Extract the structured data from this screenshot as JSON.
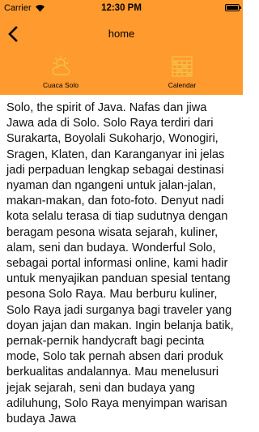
{
  "status_bar": {
    "carrier": "Carrier",
    "time": "12:30 PM"
  },
  "nav": {
    "title": "home",
    "back_icon": "chevron-left-icon"
  },
  "toolbar": {
    "items": [
      {
        "label": "Cuaca Solo",
        "icon": "weather-sun-cloud-icon"
      },
      {
        "label": "Calendar",
        "icon": "calendar-grid-icon"
      }
    ]
  },
  "colors": {
    "accent": "#fe9a2e",
    "icon": "#f5c04a"
  },
  "article": {
    "text": "Solo, the spirit of Java. Nafas dan jiwa Jawa ada di Solo. Solo Raya terdiri dari Surakarta, Boyolali Sukoharjo, Wonogiri, Sragen, Klaten, dan Karanganyar ini jelas jadi perpaduan lengkap sebagai destinasi nyaman dan ngangeni untuk jalan-jalan, makan-makan, dan foto-foto. Denyut nadi kota selalu terasa di tiap sudutnya dengan beragam pesona wisata sejarah, kuliner, alam, seni dan budaya. Wonderful Solo, sebagai portal informasi online, kami hadir untuk menyajikan panduan spesial tentang pesona Solo Raya. Mau berburu kuliner, Solo Raya jadi surganya bagi traveler yang doyan jajan dan makan. Ingin belanja batik, pernak-pernik handycraft bagi pecinta mode, Solo tak pernah absen dari produk berkualitas andalannya. Mau menelusuri jejak sejarah, seni dan budaya yang adiluhung, Solo Raya menyimpan warisan budaya Jawa"
  }
}
